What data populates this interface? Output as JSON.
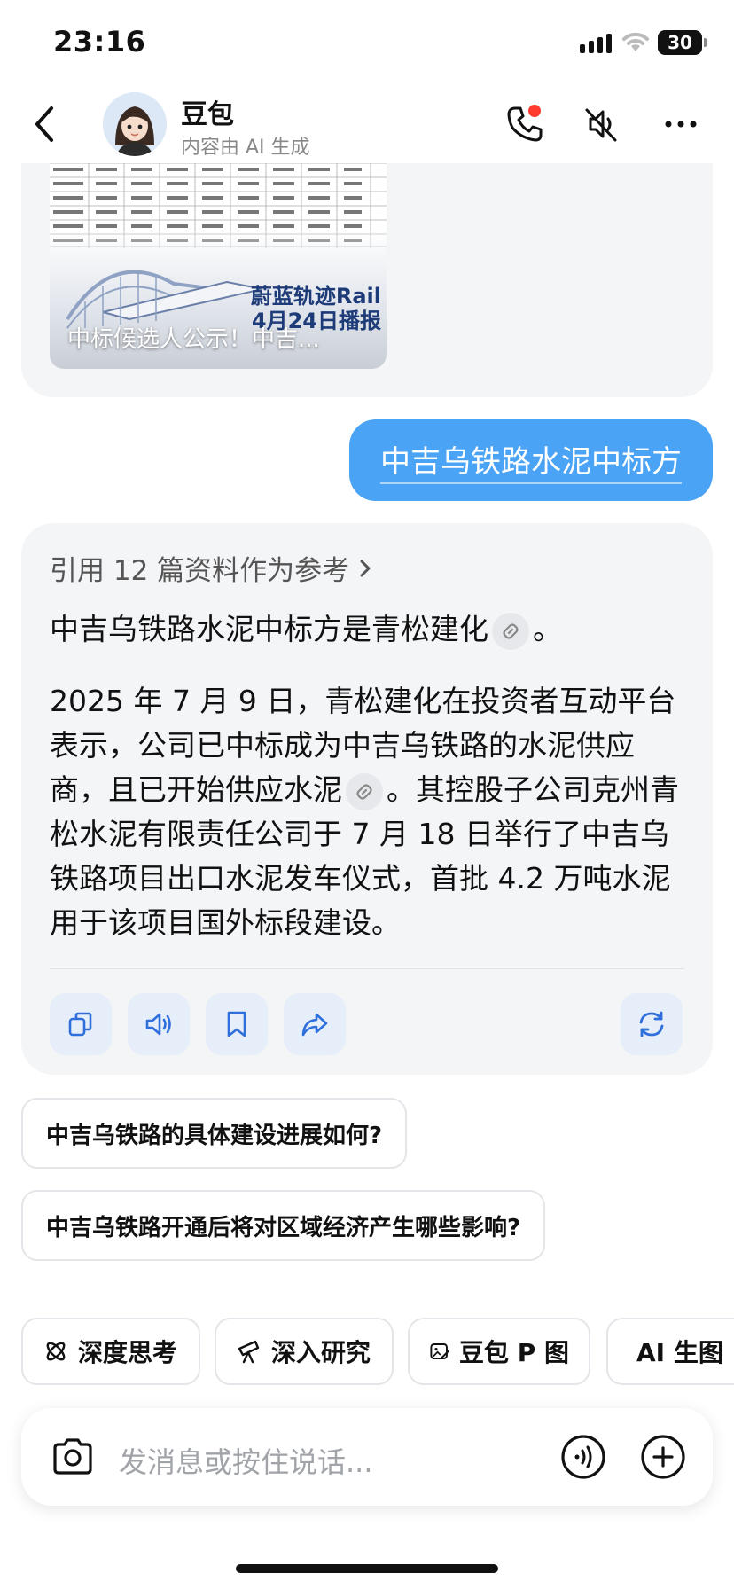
{
  "status": {
    "time": "23:16",
    "battery": "30"
  },
  "header": {
    "title": "豆包",
    "subtitle": "内容由 AI 生成"
  },
  "previous_card": {
    "brand_line1": "蔚蓝轨迹Rail",
    "brand_line2": "4月24日播报",
    "caption": "中标候选人公示！中吉..."
  },
  "user_message": "中吉乌铁路水泥中标方",
  "answer": {
    "reference": "引用 12 篇资料作为参考",
    "p1_text": "中吉乌铁路水泥中标方是青松建化",
    "p1_end": "。",
    "p2_part1": "2025 年 7 月 9 日，青松建化在投资者互动平台表示，公司已中标成为中吉乌铁路的水泥供应商，且已开始供应水泥",
    "p2_part2": "。其控股子公司克州青松水泥有限责任公司于 7 月 18 日举行了中吉乌铁路项目出口水泥发车仪式，首批 4.2 万吨水泥用于该项目国外标段建设。"
  },
  "suggestions": [
    "中吉乌铁路的具体建设进展如何?",
    "中吉乌铁路开通后将对区域经济产生哪些影响?"
  ],
  "chips": [
    {
      "label": "深度思考",
      "icon": "atom-icon"
    },
    {
      "label": "深入研究",
      "icon": "telescope-icon"
    },
    {
      "label": "豆包 P 图",
      "icon": "image-edit-icon"
    },
    {
      "label": "AI 生图",
      "icon": "image-icon"
    }
  ],
  "input": {
    "placeholder": "发消息或按住说话..."
  },
  "colors": {
    "accent": "#4aa3f5",
    "icon_blue": "#2f6fdc",
    "bubble_bg": "#f4f5f7"
  }
}
